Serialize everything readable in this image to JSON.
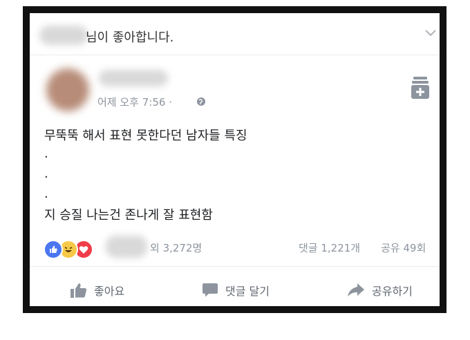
{
  "header": {
    "liked_text": "님이 좋아합니다."
  },
  "post": {
    "timestamp": "어제 오후 7:56 ·",
    "lines": [
      "무뚝뚝 해서 표현 못한다던 남자들 특징",
      ".",
      ".",
      ".",
      "지 승질 나는건 존나게 잘 표현함"
    ]
  },
  "reactions": {
    "icons": [
      "like-icon",
      "haha-icon",
      "love-icon"
    ],
    "others_text": "외 3,272명",
    "comments_text": "댓글 1,221개",
    "shares_text": "공유 49회"
  },
  "actions": {
    "like": "좋아요",
    "comment": "댓글 달기",
    "share": "공유하기"
  },
  "colors": {
    "like_blue": "#4a76f0",
    "haha_yellow": "#f7c948",
    "love_red": "#ef3e4a",
    "muted": "#8d949e"
  }
}
